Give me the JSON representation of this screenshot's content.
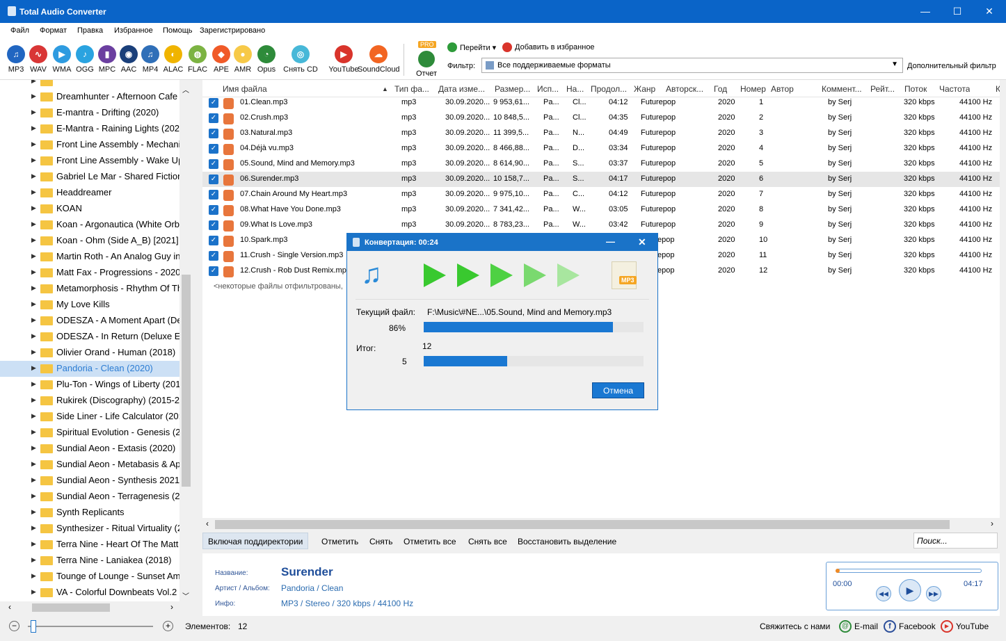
{
  "window": {
    "title": "Total Audio Converter",
    "minimize": "—",
    "maximize": "☐",
    "close": "✕"
  },
  "menu": [
    "Файл",
    "Формат",
    "Правка",
    "Избранное",
    "Помощь",
    "Зарегистрировано"
  ],
  "toolbar": {
    "formats": [
      {
        "label": "MP3",
        "color": "#2166c1",
        "glyph": "♫"
      },
      {
        "label": "WAV",
        "color": "#d93636",
        "glyph": "∿"
      },
      {
        "label": "WMA",
        "color": "#2e9be0",
        "glyph": "▶"
      },
      {
        "label": "OGG",
        "color": "#2aa3e0",
        "glyph": "♪"
      },
      {
        "label": "MPC",
        "color": "#6b3fa0",
        "glyph": "▮"
      },
      {
        "label": "AAC",
        "color": "#1a3f7a",
        "glyph": "◉"
      },
      {
        "label": "MP4",
        "color": "#2f6fb8",
        "glyph": "♫"
      },
      {
        "label": "ALAC",
        "color": "#f0b400",
        "glyph": "◐"
      },
      {
        "label": "FLAC",
        "color": "#7cb342",
        "glyph": "◍"
      },
      {
        "label": "APE",
        "color": "#f05a28",
        "glyph": "◆"
      },
      {
        "label": "AMR",
        "color": "#f7c948",
        "glyph": "●"
      },
      {
        "label": "Opus",
        "color": "#2e8b3a",
        "glyph": "◔"
      },
      {
        "label": "Снять CD",
        "color": "#47b8d8",
        "glyph": "◎"
      },
      {
        "label": "YouTube",
        "color": "#d9342b",
        "glyph": "▶"
      },
      {
        "label": "SoundCloud",
        "color": "#f26522",
        "glyph": "☁"
      }
    ],
    "report": {
      "label": "Отчет",
      "badge": "PRO"
    },
    "goto_label": "Перейти",
    "fav_label": "Добавить в избранное",
    "filter_label": "Фильтр:",
    "filter_value": "Все поддерживаемые форматы",
    "extra_filter": "Дополнительный фильтр"
  },
  "tree": {
    "items": [
      "Dreamhunter - Afternoon Cafe",
      "E-mantra - Drifting (2020)",
      "E-Mantra - Raining Lights (202",
      "Front Line Assembly - Mechani",
      "Front Line Assembly - Wake Up",
      "Gabriel Le Mar - Shared Fiction",
      "Headdreamer",
      "KOAN",
      "Koan - Argonautica (White Orb",
      "Koan - Ohm (Side A_B) [2021]",
      "Martin Roth - An Analog Guy in",
      "Matt Fax - Progressions - 2020",
      "Metamorphosis - Rhythm Of Th",
      "My Love Kills",
      "ODESZA - A Moment Apart (De",
      "ODESZA - In Return (Deluxe Ed",
      "Olivier Orand - Human (2018)",
      "Pandoria - Clean (2020)",
      "Plu-Ton - Wings of Liberty (201",
      "Rukirek (Discography) (2015-20",
      "Side Liner - Life Calculator (20:",
      "Spiritual Evolution - Genesis (2",
      "Sundial Aeon - Extasis (2020)",
      "Sundial Aeon - Metabasis & Ap",
      "Sundial Aeon - Synthesis 2021",
      "Sundial Aeon - Terragenesis (2",
      "Synth Replicants",
      "Synthesizer - Ritual Virtuality (20",
      "Terra Nine - Heart Of The Matt",
      "Terra Nine - Laniakea (2018)",
      "Tounge of Lounge - Sunset Am",
      "VA - Colorful Downbeats Vol.2"
    ],
    "selected_index": 17
  },
  "columns": [
    "Имя файла",
    "Тип фа...",
    "Дата изме...",
    "Размер...",
    "Исп...",
    "На...",
    "Продол...",
    "Жанр",
    "Авторск...",
    "Год",
    "Номер",
    "Автор",
    "Коммент...",
    "Рейт...",
    "Поток",
    "Частота",
    "К"
  ],
  "files": [
    [
      "01.Clean.mp3",
      "mp3",
      "30.09.2020...",
      "9 953,61...",
      "Pa...",
      "Cl...",
      "04:12",
      "Futurepop",
      "2020",
      "1",
      "by Serj",
      "320 kbps",
      "44100 Hz"
    ],
    [
      "02.Crush.mp3",
      "mp3",
      "30.09.2020...",
      "10 848,5...",
      "Pa...",
      "Cl...",
      "04:35",
      "Futurepop",
      "2020",
      "2",
      "by Serj",
      "320 kbps",
      "44100 Hz"
    ],
    [
      "03.Natural.mp3",
      "mp3",
      "30.09.2020...",
      "11 399,5...",
      "Pa...",
      "N...",
      "04:49",
      "Futurepop",
      "2020",
      "3",
      "by Serj",
      "320 kbps",
      "44100 Hz"
    ],
    [
      "04.Déjà vu.mp3",
      "mp3",
      "30.09.2020...",
      "8 466,88...",
      "Pa...",
      "D...",
      "03:34",
      "Futurepop",
      "2020",
      "4",
      "by Serj",
      "320 kbps",
      "44100 Hz"
    ],
    [
      "05.Sound, Mind and Memory.mp3",
      "mp3",
      "30.09.2020...",
      "8 614,90...",
      "Pa...",
      "S...",
      "03:37",
      "Futurepop",
      "2020",
      "5",
      "by Serj",
      "320 kbps",
      "44100 Hz"
    ],
    [
      "06.Surender.mp3",
      "mp3",
      "30.09.2020...",
      "10 158,7...",
      "Pa...",
      "S...",
      "04:17",
      "Futurepop",
      "2020",
      "6",
      "by Serj",
      "320 kbps",
      "44100 Hz"
    ],
    [
      "07.Chain Around My Heart.mp3",
      "mp3",
      "30.09.2020...",
      "9 975,10...",
      "Pa...",
      "C...",
      "04:12",
      "Futurepop",
      "2020",
      "7",
      "by Serj",
      "320 kbps",
      "44100 Hz"
    ],
    [
      "08.What Have You Done.mp3",
      "mp3",
      "30.09.2020...",
      "7 341,42...",
      "Pa...",
      "W...",
      "03:05",
      "Futurepop",
      "2020",
      "8",
      "by Serj",
      "320 kbps",
      "44100 Hz"
    ],
    [
      "09.What Is Love.mp3",
      "mp3",
      "30.09.2020...",
      "8 783,23...",
      "Pa...",
      "W...",
      "03:42",
      "Futurepop",
      "2020",
      "9",
      "by Serj",
      "320 kbps",
      "44100 Hz"
    ],
    [
      "10.Spark.mp3",
      "",
      "",
      "",
      "",
      "",
      "",
      "epop",
      "2020",
      "10",
      "by Serj",
      "320 kbps",
      "44100 Hz"
    ],
    [
      "11.Crush - Single Version.mp3",
      "",
      "",
      "",
      "",
      "",
      "",
      "epop",
      "2020",
      "11",
      "by Serj",
      "320 kbps",
      "44100 Hz"
    ],
    [
      "12.Crush - Rob Dust Remix.mp3",
      "",
      "",
      "",
      "",
      "",
      "",
      "epop",
      "2020",
      "12",
      "by Serj",
      "320 kbps",
      "44100 Hz"
    ]
  ],
  "filtered_note": "<некоторые файлы отфильтрованы,",
  "actions": [
    "Включая поддиректории",
    "Отметить",
    "Снять",
    "Отметить все",
    "Снять все",
    "Восстановить выделение"
  ],
  "search_placeholder": "Поиск...",
  "info": {
    "name_label": "Название:",
    "name": "Surender",
    "artist_label": "Артист / Альбом:",
    "artist": "Pandoria / Clean",
    "info_label": "Инфо:",
    "info": "MP3 / Stereo / 320 kbps / 44100 Hz"
  },
  "player": {
    "start": "00:00",
    "end": "04:17"
  },
  "status": {
    "elements_label": "Элементов:",
    "elements": "12",
    "contact": "Свяжитесь с нами",
    "email": "E-mail",
    "facebook": "Facebook",
    "youtube": "YouTube"
  },
  "dialog": {
    "title": "Конвертация: 00:24",
    "current_label": "Текущий файл:",
    "current_file": "F:\\Music\\#NE...\\05.Sound, Mind and Memory.mp3",
    "current_pct_text": "86%",
    "current_progress": 0.86,
    "total_label": "Итог:",
    "total_count": "12",
    "done_count": "5",
    "total_progress": 0.38,
    "cancel": "Отмена",
    "target_badge": "MP3"
  }
}
